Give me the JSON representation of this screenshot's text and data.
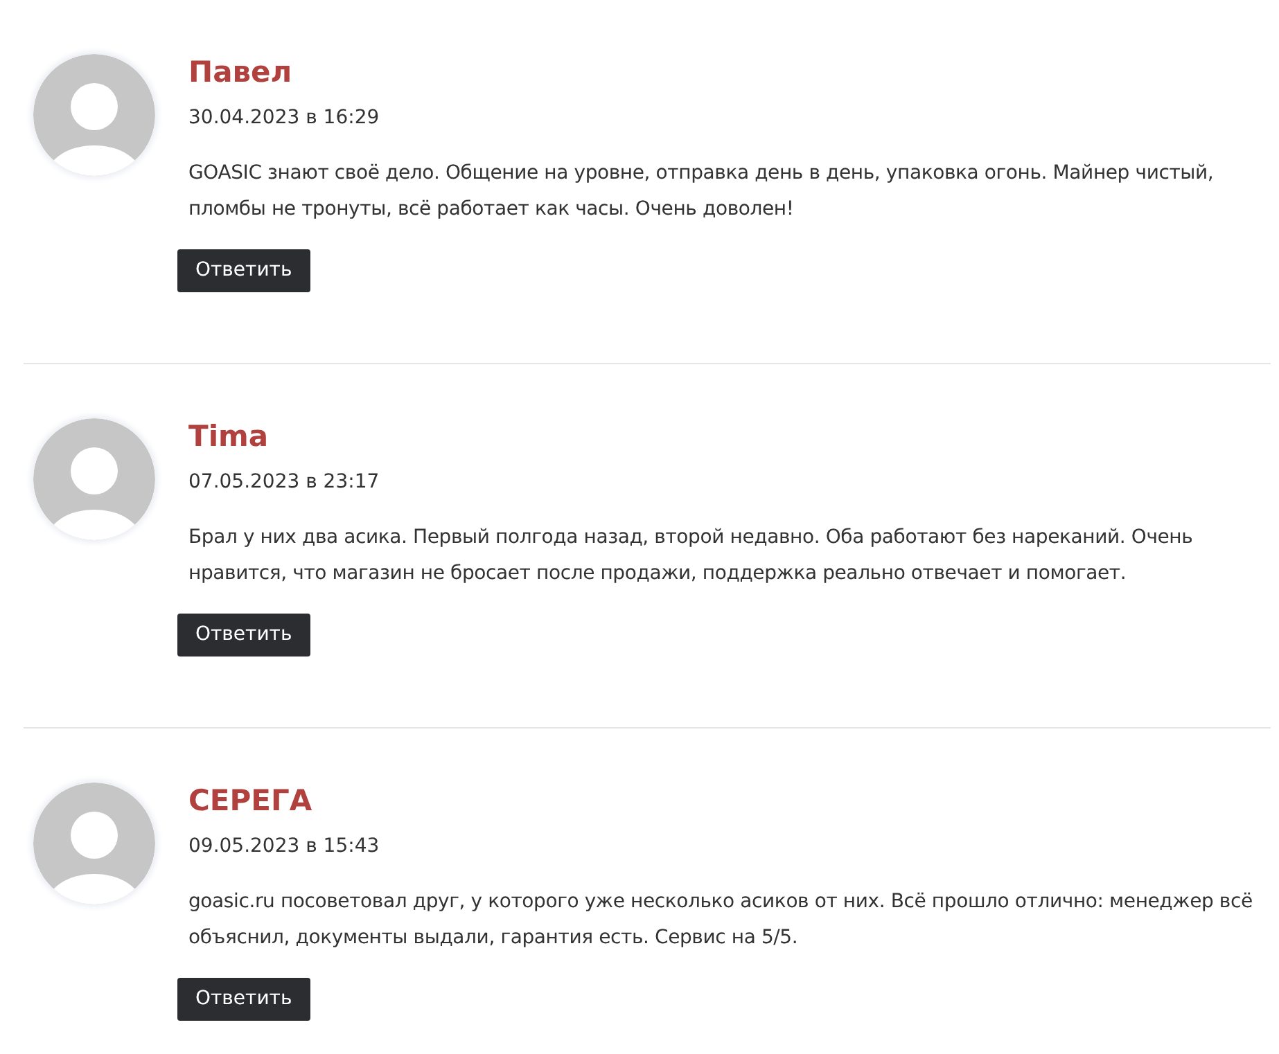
{
  "comments": [
    {
      "author": "Павел",
      "date": "30.04.2023 в 16:29",
      "text": "GOASIC знают своё дело. Общение на уровне, отправка день в день, упаковка огонь. Майнер чистый, пломбы не тронуты, всё работает как часы. Очень доволен!",
      "reply": "Ответить"
    },
    {
      "author": "Tima",
      "date": "07.05.2023 в 23:17",
      "text": "Брал у них два асика. Первый полгода назад, второй недавно. Оба работают без нареканий. Очень нравится, что магазин не бросает после продажи, поддержка реально отвечает и помогает.",
      "reply": "Ответить"
    },
    {
      "author": "СЕРЕГА",
      "date": "09.05.2023 в 15:43",
      "text": "goasic.ru посоветовал друг, у которого уже несколько асиков от них. Всё прошло отлично: менеджер всё объяснил, документы выдали, гарантия есть. Сервис на 5/5.",
      "reply": "Ответить"
    }
  ]
}
